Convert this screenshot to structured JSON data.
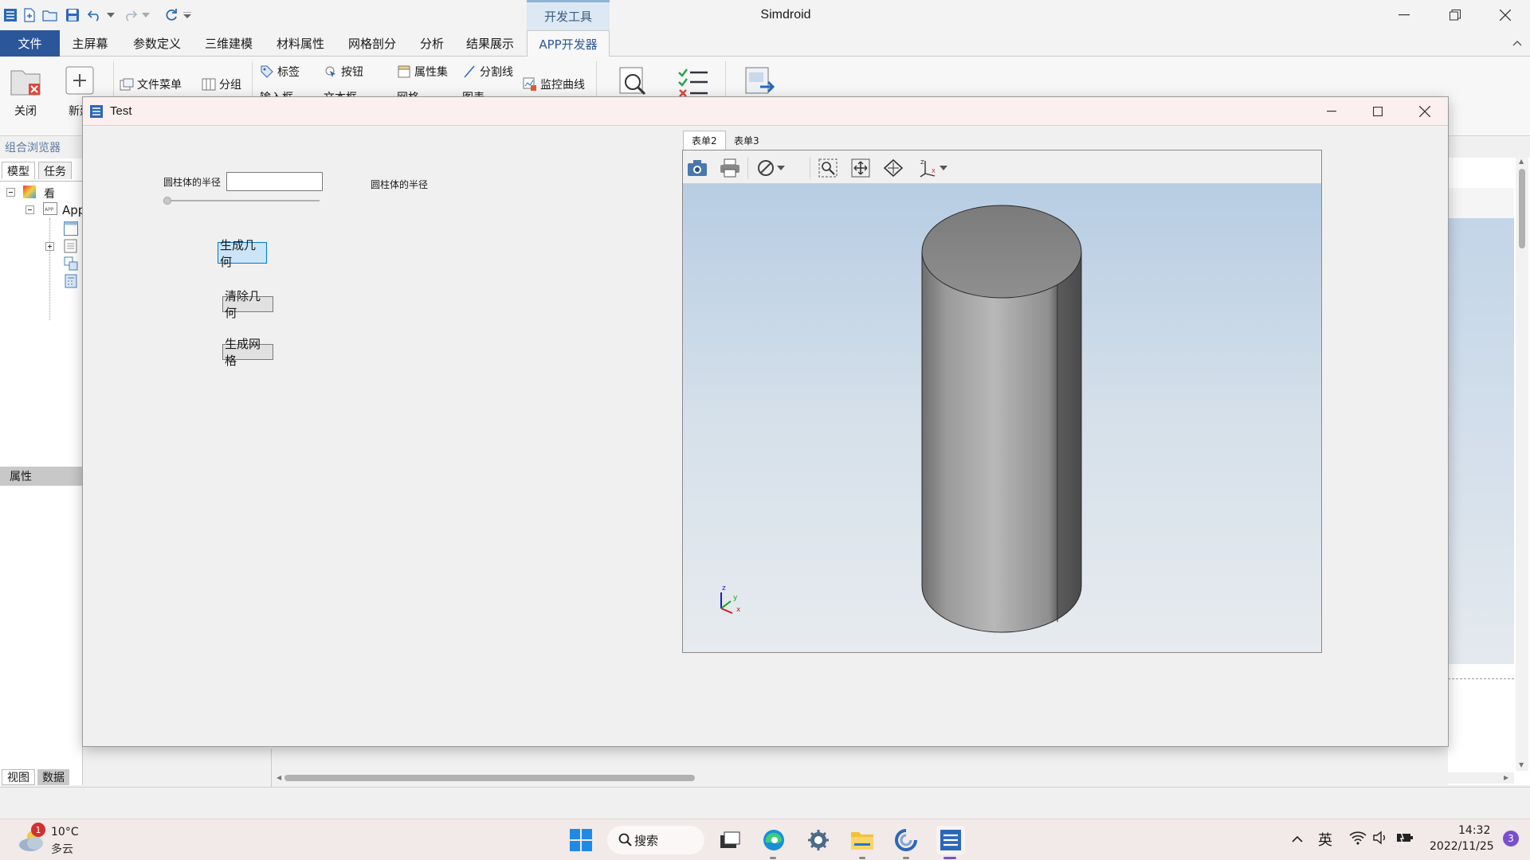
{
  "app": {
    "title": "Simdroid",
    "context_tab": "开发工具"
  },
  "menu": {
    "file": "文件",
    "items": [
      "主屏幕",
      "参数定义",
      "三维建模",
      "材料属性",
      "网格剖分",
      "分析",
      "结果展示",
      "APP开发器"
    ]
  },
  "ribbon": {
    "close": "关闭",
    "new": "新建",
    "file_menu": "文件菜单",
    "group": "分组",
    "label": "标签",
    "button": "按钮",
    "property_set": "属性集",
    "divider": "分割线",
    "monitor_curve": "监控曲线",
    "input_box_partial": "输入框",
    "text_box_partial": "文本框",
    "grid_partial": "网格",
    "chart_partial": "图表"
  },
  "left_panel": {
    "browser_title": "组合浏览器",
    "tab_model": "模型",
    "tab_task": "任务",
    "tree_root": "看",
    "tree_app": "App",
    "properties": "属性",
    "bottom_tab_view": "视图",
    "bottom_tab_data": "数据"
  },
  "dialog": {
    "title": "Test",
    "radius_label": "圆柱体的半径",
    "radius_value": "",
    "radius_echo": "圆柱体的半径",
    "slider_value": 0,
    "btn_generate": "生成几何",
    "btn_clear": "清除几何",
    "btn_mesh": "生成网格",
    "viewer_tabs": [
      "表单2",
      "表单3"
    ],
    "axis_x": "x",
    "axis_y": "y",
    "axis_z": "z"
  },
  "taskbar": {
    "weather_temp": "10°C",
    "weather_desc": "多云",
    "weather_badge": "1",
    "search": "搜索",
    "ime": "英",
    "time": "14:32",
    "date": "2022/11/25",
    "notif_count": "3"
  },
  "colors": {
    "accent": "#2b579a",
    "viewport_top": "#b7cde3",
    "viewport_bottom": "#e7ebef",
    "cylinder": "#8c8c8c"
  }
}
